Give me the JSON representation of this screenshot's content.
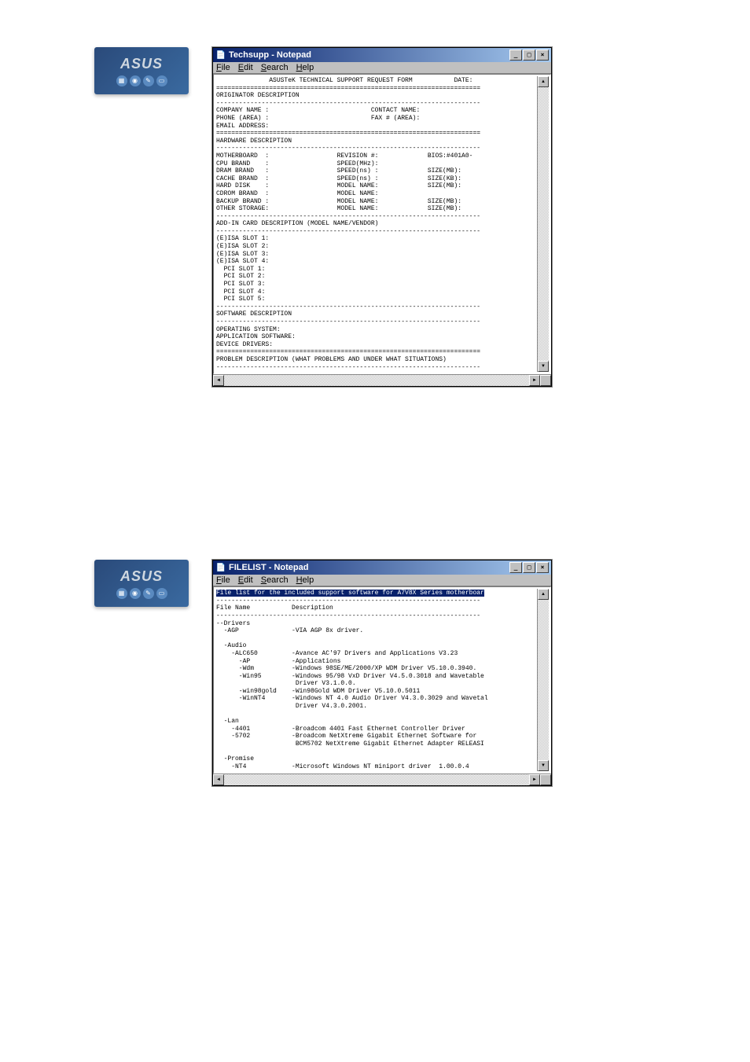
{
  "asus": {
    "brand": "ASUS"
  },
  "notepad1": {
    "title": "Techsupp - Notepad",
    "menu": {
      "file": "File",
      "edit": "Edit",
      "search": "Search",
      "help": "Help"
    },
    "content": "              ASUSTeK TECHNICAL SUPPORT REQUEST FORM           DATE:\n======================================================================\nORIGINATOR DESCRIPTION\n----------------------------------------------------------------------\nCOMPANY NAME :                           CONTACT NAME:\nPHONE (AREA) :                           FAX # (AREA):\nEMAIL ADDRESS:\n======================================================================\nHARDWARE DESCRIPTION\n----------------------------------------------------------------------\nMOTHERBOARD  :                  REVISION #:             BIOS:#401A0-\nCPU BRAND    :                  SPEED(MHz):\nDRAM BRAND   :                  SPEED(ns) :             SIZE(MB):\nCACHE BRAND  :                  SPEED(ns) :             SIZE(KB):\nHARD DISK    :                  MODEL NAME:             SIZE(MB):\nCDROM BRAND  :                  MODEL NAME:\nBACKUP BRAND :                  MODEL NAME:             SIZE(MB):\nOTHER STORAGE:                  MODEL NAME:             SIZE(MB):\n----------------------------------------------------------------------\nADD-IN CARD DESCRIPTION (MODEL NAME/VENDOR)\n----------------------------------------------------------------------\n(E)ISA SLOT 1:\n(E)ISA SLOT 2:\n(E)ISA SLOT 3:\n(E)ISA SLOT 4:\n  PCI SLOT 1:\n  PCI SLOT 2:\n  PCI SLOT 3:\n  PCI SLOT 4:\n  PCI SLOT 5:\n----------------------------------------------------------------------\nSOFTWARE DESCRIPTION\n----------------------------------------------------------------------\nOPERATING SYSTEM:\nAPPLICATION SOFTWARE:\nDEVICE DRIVERS:\n======================================================================\nPROBLEM DESCRIPTION (WHAT PROBLEMS AND UNDER WHAT SITUATIONS)\n----------------------------------------------------------------------\n"
  },
  "notepad2": {
    "title": "FILELIST - Notepad",
    "menu": {
      "file": "File",
      "edit": "Edit",
      "search": "Search",
      "help": "Help"
    },
    "content_pre": "File list for the included support software for A7V8X Series motherboar",
    "content_rest": "\n----------------------------------------------------------------------\nFile Name           Description\n----------------------------------------------------------------------\n--Drivers\n  -AGP              -VIA AGP 8x driver.\n\n  -Audio\n    -ALC650         -Avance AC'97 Drivers and Applications V3.23\n      -AP           -Applications\n      -Wdm          -Windows 98SE/ME/2000/XP WDM Driver V5.10.0.3940.\n      -Win95        -Windows 95/98 VxD Driver V4.5.0.3018 and Wavetable\n                     Driver V3.1.0.0.\n      -win98gold    -Win98Gold WDM Driver V5.10.0.5011\n      -WinNT4       -Windows NT 4.0 Audio Driver V4.3.0.3029 and Wavetal\n                     Driver V4.3.0.2001.\n\n  -Lan\n    -4401           -Broadcom 4401 Fast Ethernet Controller Driver\n    -5702           -Broadcom NetXtreme Gigabit Ethernet Software for\n                     BCM5702 NetXtreme Gigabit Ethernet Adapter RELEASI\n\n  -Promise\n    -NT4            -Microsoft Windows NT miniport driver  1.00.0.4"
  }
}
